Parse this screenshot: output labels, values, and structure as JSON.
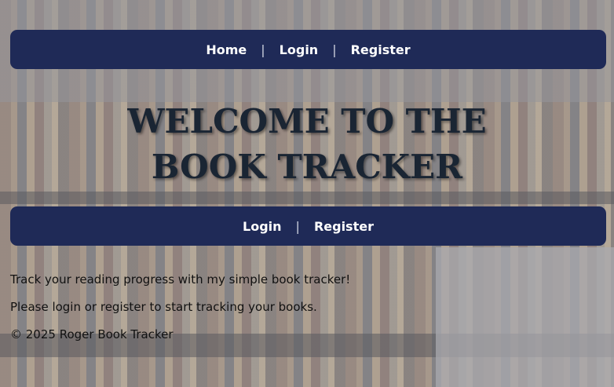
{
  "top_nav": {
    "home": "Home",
    "login": "Login",
    "register": "Register",
    "separator": "|"
  },
  "title": "WELCOME TO THE BOOK TRACKER",
  "auth_nav": {
    "login": "Login",
    "register": "Register",
    "separator": "|"
  },
  "intro": {
    "line1": "Track your reading progress with my simple book tracker!",
    "line2": "Please login or register to start tracking your books."
  },
  "footer": {
    "copyright": "© 2025 Roger Book Tracker"
  },
  "colors": {
    "nav_background": "#1f2a57",
    "nav_text": "#ffffff",
    "title_text": "#1a2533"
  }
}
